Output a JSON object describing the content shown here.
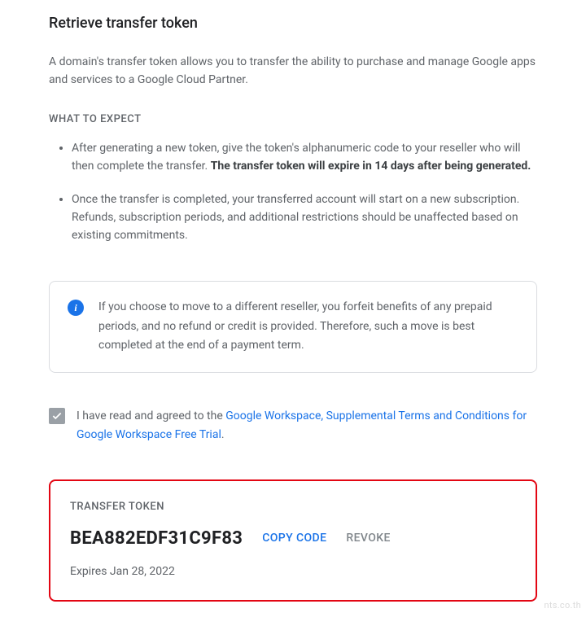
{
  "title": "Retrieve transfer token",
  "description": "A domain's transfer token allows you to transfer the ability to purchase and manage Google apps and services to a Google Cloud Partner.",
  "whatToExpect": {
    "heading": "WHAT TO EXPECT",
    "bullets": [
      {
        "textBefore": "After generating a new token, give the token's alphanumeric code to your reseller who will then complete the transfer. ",
        "bold": "The transfer token will expire in 14 days after being generated.",
        "textAfter": ""
      },
      {
        "textBefore": "Once the transfer is completed, your transferred account will start on a new subscription. Refunds, subscription periods, and additional restrictions should be unaffected based on existing commitments.",
        "bold": "",
        "textAfter": ""
      }
    ]
  },
  "infoNotice": "If you choose to move to a different reseller, you forfeit benefits of any prepaid periods, and no refund or credit is provided. Therefore, such a move is best completed at the end of a payment term.",
  "consent": {
    "prefix": "I have read and agreed to the ",
    "linkText": "Google Workspace, Supplemental Terms and Conditions for Google Workspace Free Trial",
    "suffix": "."
  },
  "tokenPanel": {
    "label": "TRANSFER TOKEN",
    "code": "BEA882EDF31C9F83",
    "copyLabel": "COPY CODE",
    "revokeLabel": "REVOKE",
    "expires": "Expires Jan 28, 2022"
  },
  "watermark": "nts.co.th"
}
